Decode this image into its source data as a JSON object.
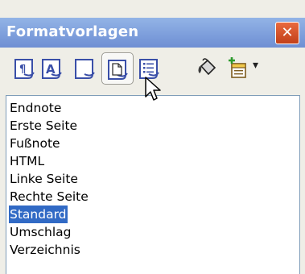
{
  "window": {
    "title": "Formatvorlagen",
    "close_label": "✕"
  },
  "toolbar": {
    "buttons": [
      {
        "icon": "paragraph-styles-icon"
      },
      {
        "icon": "character-styles-icon"
      },
      {
        "icon": "frame-styles-icon"
      },
      {
        "icon": "page-styles-icon",
        "active": true
      },
      {
        "icon": "list-styles-icon"
      },
      {
        "icon": "fill-format-mode-icon"
      },
      {
        "icon": "new-style-from-selection-icon"
      }
    ],
    "dropdown_arrow": "▾"
  },
  "styles_list": {
    "items": [
      "Endnote",
      "Erste Seite",
      "Fußnote",
      "HTML",
      "Linke Seite",
      "Rechte Seite",
      "Standard",
      "Umschlag",
      "Verzeichnis"
    ],
    "selected": "Standard"
  },
  "colors": {
    "selection": "#316ac5",
    "titlebar": "#7e9fdc",
    "close": "#d4522a"
  }
}
